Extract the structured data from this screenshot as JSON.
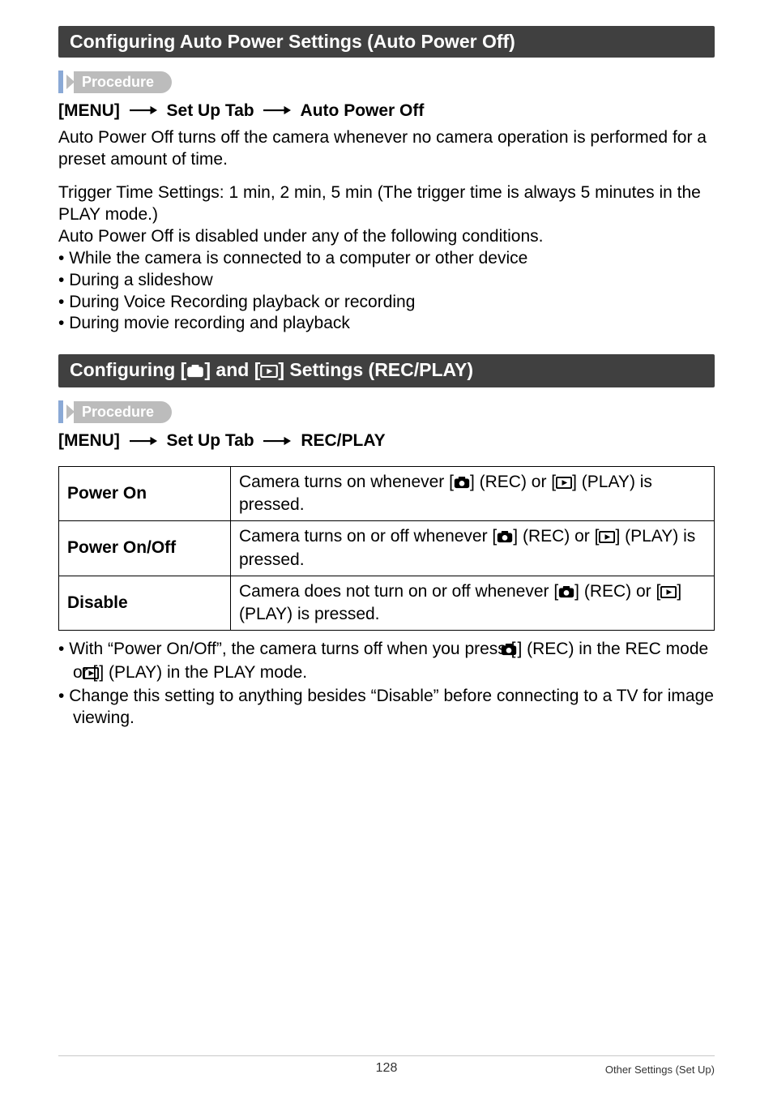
{
  "sections": {
    "auto_power_off": {
      "title": "Configuring Auto Power Settings (Auto Power Off)",
      "procedure_label": "Procedure",
      "path_prefix": "[MENU]",
      "path_mid": "Set Up Tab",
      "path_end": "Auto Power Off",
      "intro": "Auto Power Off turns off the camera whenever no camera operation is performed for a preset amount of time.",
      "trigger": "Trigger Time Settings: 1 min, 2 min, 5 min (The trigger time is always 5 minutes in the PLAY mode.)",
      "disabled_intro": "Auto Power Off is disabled under any of the following conditions.",
      "bullets": [
        "While the camera is connected to a computer or other device",
        "During a slideshow",
        "During Voice Recording playback or recording",
        "During movie recording and playback"
      ]
    },
    "rec_play": {
      "title_prefix": "Configuring [",
      "title_mid": "] and [",
      "title_suffix": "] Settings (REC/PLAY)",
      "procedure_label": "Procedure",
      "path_prefix": "[MENU]",
      "path_mid": "Set Up Tab",
      "path_end": "REC/PLAY",
      "table": {
        "power_on": {
          "label": "Power On",
          "desc_prefix": "Camera turns on whenever [",
          "desc_mid": "] (REC) or [",
          "desc_suffix": "] (PLAY) is pressed."
        },
        "power_on_off": {
          "label": "Power On/Off",
          "desc_prefix": "Camera turns on or off whenever [",
          "desc_mid": "] (REC) or [",
          "desc_suffix": "] (PLAY) is pressed."
        },
        "disable": {
          "label": "Disable",
          "desc_prefix": "Camera does not turn on or off whenever [",
          "desc_mid": "] (REC) or [",
          "desc_suffix": "] (PLAY) is pressed."
        }
      },
      "notes": {
        "n1_a": "With “Power On/Off”, the camera turns off when you press [",
        "n1_b": "] (REC) in the REC mode or [",
        "n1_c": "] (PLAY) in the PLAY mode.",
        "n2": "Change this setting to anything besides “Disable” before connecting to a TV for image viewing."
      }
    }
  },
  "footer": {
    "page": "128",
    "label": "Other Settings (Set Up)"
  }
}
